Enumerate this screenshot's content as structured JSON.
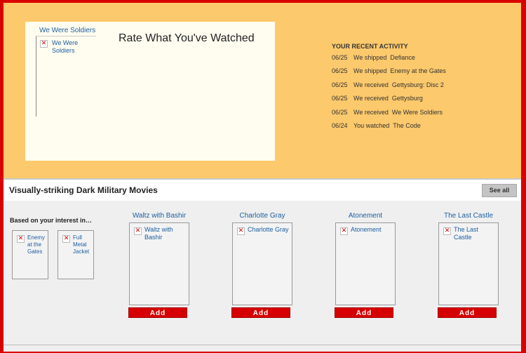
{
  "rate_panel": {
    "film_title": "We Were Soldiers",
    "thumb_label": "We Were Soldiers",
    "heading": "Rate What You've Watched"
  },
  "activity": {
    "heading": "YOUR RECENT ACTIVITY",
    "rows": [
      {
        "date": "06/25",
        "verb": "We shipped",
        "title": "Defiance"
      },
      {
        "date": "06/25",
        "verb": "We shipped",
        "title": "Enemy at the Gates"
      },
      {
        "date": "06/25",
        "verb": "We received",
        "title": "Gettysburg: Disc 2"
      },
      {
        "date": "06/25",
        "verb": "We received",
        "title": "Gettysburg"
      },
      {
        "date": "06/25",
        "verb": "We received",
        "title": "We Were Soldiers"
      },
      {
        "date": "06/24",
        "verb": "You watched",
        "title": "The Code"
      }
    ]
  },
  "row": {
    "title": "Visually-striking Dark Military Movies",
    "see_all": "See all",
    "based_on": "Based on your interest in…",
    "interest": [
      {
        "label": "Enemy at the Gates"
      },
      {
        "label": "Full Metal Jacket"
      }
    ],
    "movies": [
      {
        "title": "Waltz with Bashir",
        "thumb_label": "Waltz with Bashir",
        "add": "Add"
      },
      {
        "title": "Charlotte Gray",
        "thumb_label": "Charlotte Gray",
        "add": "Add"
      },
      {
        "title": "Atonement",
        "thumb_label": "Atonement",
        "add": "Add"
      },
      {
        "title": "The Last Castle",
        "thumb_label": "The Last Castle",
        "add": "Add"
      }
    ]
  },
  "icons": {
    "broken_image": "broken-image-icon"
  },
  "colors": {
    "accent": "#d90000",
    "top_background": "#fcc96c",
    "link": "#1c5e9e"
  }
}
